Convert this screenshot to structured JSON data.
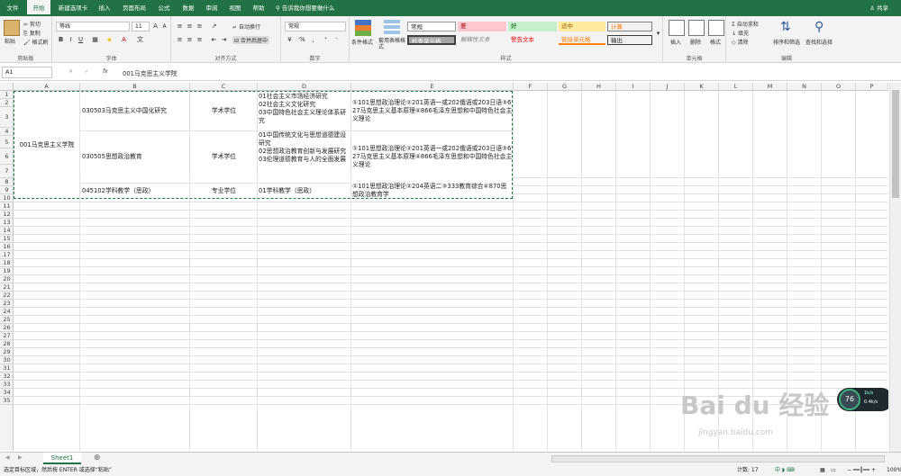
{
  "ribbon_tabs": [
    "文件",
    "开始",
    "新建选项卡",
    "插入",
    "页面布局",
    "公式",
    "数据",
    "审阅",
    "视图",
    "帮助"
  ],
  "tell_me": "告诉我你想要做什么",
  "share": "共享",
  "clipboard": {
    "paste": "粘贴",
    "cut": "剪切",
    "copy": "复制",
    "format_painter": "格式刷",
    "label": "剪贴板"
  },
  "font": {
    "name": "等线",
    "size": "11",
    "label": "字体"
  },
  "alignment": {
    "wrap": "自动换行",
    "merge": "合并后居中",
    "label": "对齐方式"
  },
  "number": {
    "format": "常规",
    "label": "数字"
  },
  "styles": {
    "conditional": "条件格式",
    "as_table": "套用表格格式",
    "label": "样式",
    "items": [
      "常规",
      "差",
      "好",
      "适中",
      "计算",
      "检查单元格",
      "解释性文本",
      "警告文本",
      "链接单元格",
      "输出"
    ]
  },
  "cells": {
    "insert": "插入",
    "delete": "删除",
    "format": "格式",
    "label": "单元格"
  },
  "editing": {
    "autosum": "自动求和",
    "fill": "填充",
    "clear": "清除",
    "sort": "排序和筛选",
    "find": "查找和选择",
    "label": "编辑"
  },
  "name_box": "A1",
  "formula": "001马克思主义学院",
  "columns": [
    "A",
    "B",
    "C",
    "D",
    "E",
    "F",
    "G",
    "H",
    "I",
    "J",
    "K",
    "L",
    "M",
    "N",
    "O",
    "P"
  ],
  "rows": [
    "1",
    "2",
    "3",
    "4",
    "5",
    "6",
    "7",
    "8",
    "9",
    "10",
    "11",
    "12",
    "13",
    "14",
    "15",
    "16",
    "17",
    "18",
    "19",
    "20",
    "21",
    "22",
    "23",
    "24",
    "25",
    "26",
    "27",
    "28",
    "29",
    "30",
    "31",
    "32",
    "33",
    "34",
    "35"
  ],
  "data": {
    "a1": "001马克思主义学院",
    "b_1": "030503马克思主义中国化研究",
    "c_1": "学术学位",
    "d_1": "01社会主义市场经济研究\n02社会主义文化研究\n03中国特色社会主义理论体系研究",
    "e_1": "①101思想政治理论②201英语一或202俄语或203日语③627马克思主义基本原理④866毛泽东思想和中国特色社会主义理论",
    "b_2": "030505思想政治教育",
    "c_2": "学术学位",
    "d_2": "01中国传统文化与思想道德建设研究\n02思想政治教育创新与发展研究\n03伦理道德教育与人的全面发展",
    "e_2": "①101思想政治理论②201英语一或202俄语或203日语③627马克思主义基本原理④866毛泽东思想和中国特色社会主义理论",
    "b_3": "045102学科教学（思政）",
    "c_3": "专业学位",
    "d_3": "01学科教学（思政）",
    "e_3": "①101思想政治理论②204英语二③333教育综合④870思想政治教育学"
  },
  "sheet_tab": "Sheet1",
  "status": "选定目标区域，然后按 ENTER 或选择“粘贴”",
  "count": "计数: 17",
  "zoom": "100%",
  "widget": {
    "pct": "76",
    "up": "1k/s",
    "down": "0.4k/s"
  },
  "watermark": {
    "brand": "Bai du 经验",
    "url": "jingyan.baidu.com"
  },
  "colors": {
    "excel_green": "#217346"
  }
}
